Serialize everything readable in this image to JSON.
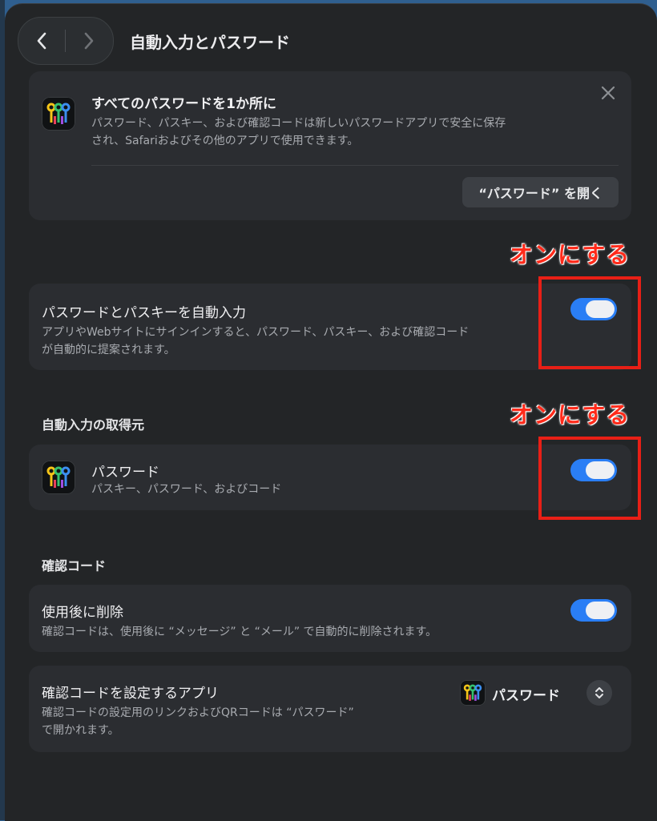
{
  "window": {
    "title": "自動入力とパスワード"
  },
  "banner": {
    "title": "すべてのパスワードを1か所に",
    "description_line1": "パスワード、パスキー、および確認コードは新しいパスワードアプリで安全に保存",
    "description_line2": "され、Safariおよびその他のアプリで使用できます。",
    "open_button": "“パスワード” を開く"
  },
  "annotations": {
    "turn_on_1": "オンにする",
    "turn_on_2": "オンにする"
  },
  "autofill": {
    "title": "パスワードとパスキーを自動入力",
    "description_line1": "アプリやWebサイトにサインインすると、パスワード、パスキー、および確認コード",
    "description_line2": "が自動的に提案されます。",
    "enabled": true
  },
  "sources": {
    "header": "自動入力の取得元",
    "item": {
      "title": "パスワード",
      "subtitle": "パスキー、パスワード、およびコード",
      "enabled": true
    }
  },
  "codes": {
    "header": "確認コード",
    "delete_after_use": {
      "title": "使用後に削除",
      "description": "確認コードは、使用後に “メッセージ” と “メール” で自動的に削除されます。",
      "enabled": true
    },
    "setup_app": {
      "title": "確認コードを設定するアプリ",
      "description_line1": "確認コードの設定用のリンクおよびQRコードは “パスワード”",
      "description_line2": "で開かれます。",
      "selected": "パスワード"
    }
  },
  "colors": {
    "toggle_on": "#2a7ef5",
    "annotation": "#e81f16"
  },
  "icons": [
    "chevron-left-icon",
    "chevron-right-icon",
    "close-icon",
    "passwords-app-icon",
    "up-down-chevron-icon"
  ]
}
